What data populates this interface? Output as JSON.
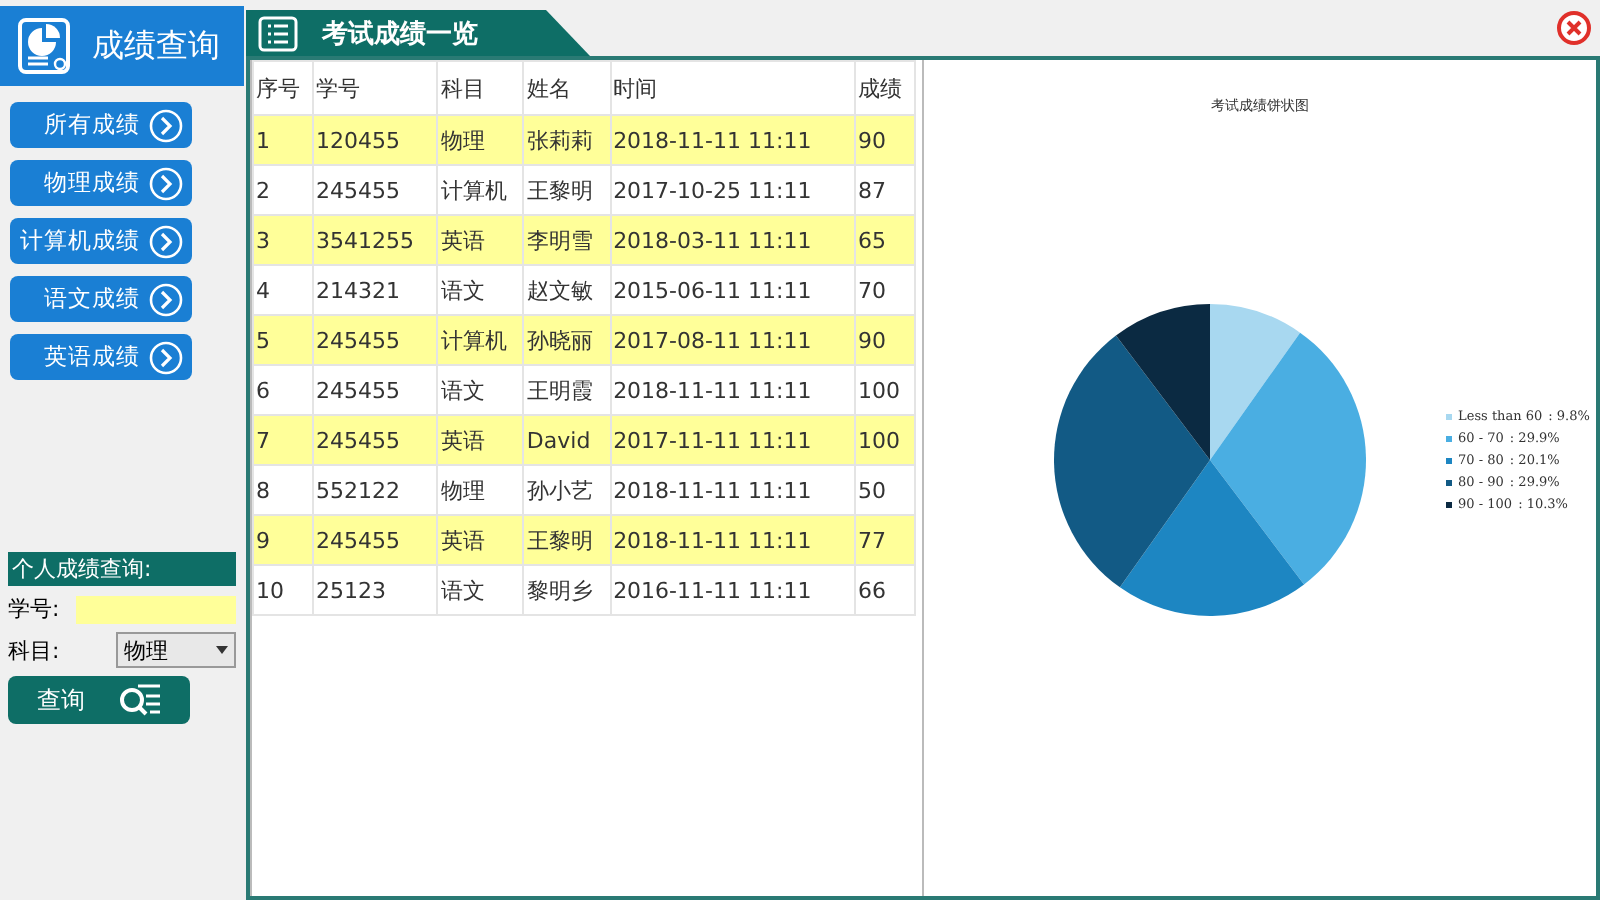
{
  "sidebar": {
    "title": "成绩查询",
    "items": [
      {
        "label": "所有成绩"
      },
      {
        "label": "物理成绩"
      },
      {
        "label": "计算机成绩"
      },
      {
        "label": "语文成绩"
      },
      {
        "label": "英语成绩"
      }
    ],
    "query": {
      "title": "个人成绩查询:",
      "id_label": "学号:",
      "subject_label": "科目:",
      "subject_value": "物理",
      "button": "查询"
    }
  },
  "panel": {
    "title": "考试成绩一览"
  },
  "table": {
    "columns": [
      "序号",
      "学号",
      "科目",
      "姓名",
      "时间",
      "成绩"
    ],
    "rows": [
      [
        "1",
        "120455",
        "物理",
        "张莉莉",
        "2018-11-11 11:11",
        "90"
      ],
      [
        "2",
        "245455",
        "计算机",
        "王黎明",
        "2017-10-25 11:11",
        "87"
      ],
      [
        "3",
        "3541255",
        "英语",
        "李明雪",
        "2018-03-11 11:11",
        "65"
      ],
      [
        "4",
        "214321",
        "语文",
        "赵文敏",
        "2015-06-11 11:11",
        "70"
      ],
      [
        "5",
        "245455",
        "计算机",
        "孙晓丽",
        "2017-08-11 11:11",
        "90"
      ],
      [
        "6",
        "245455",
        "语文",
        "王明霞",
        "2018-11-11 11:11",
        "100"
      ],
      [
        "7",
        "245455",
        "英语",
        "David",
        "2017-11-11 11:11",
        "100"
      ],
      [
        "8",
        "552122",
        "物理",
        "孙小艺",
        "2018-11-11 11:11",
        "50"
      ],
      [
        "9",
        "245455",
        "英语",
        "王黎明",
        "2018-11-11 11:11",
        "77"
      ],
      [
        "10",
        "25123",
        "语文",
        "黎明乡",
        "2016-11-11 11:11",
        "66"
      ]
    ]
  },
  "chart": {
    "chart_data": {
      "type": "pie",
      "legend": "right",
      "title": "考试成绩饼状图",
      "categories": [
        "Less than 60",
        "60 - 70",
        "70 - 80",
        "80 - 90",
        "90 - 100"
      ],
      "values": [
        9.8,
        29.9,
        20.1,
        29.9,
        10.3
      ],
      "value_labels": [
        ": 9.8%",
        ": 29.9%",
        ": 20.1%",
        ": 29.9%",
        ": 10.3%"
      ],
      "colors": [
        "#a8d8f0",
        "#4aaee2",
        "#1d86c2",
        "#125a85",
        "#0b2a42"
      ]
    }
  }
}
